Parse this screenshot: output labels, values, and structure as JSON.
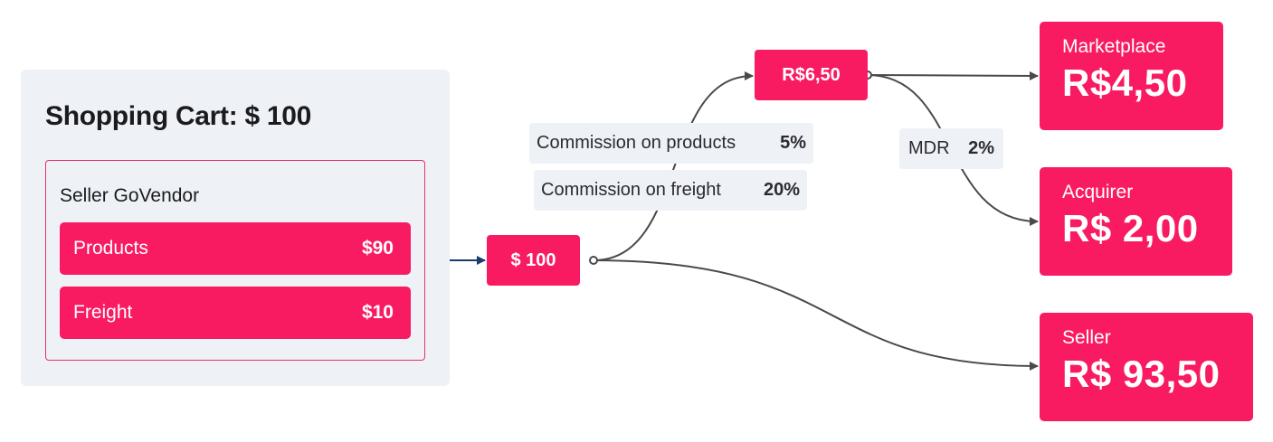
{
  "cart": {
    "title": "Shopping Cart: $ 100",
    "seller_name": "Seller GoVendor",
    "items": [
      {
        "label": "Products",
        "amount": "$90"
      },
      {
        "label": "Freight",
        "amount": "$10"
      }
    ]
  },
  "flow": {
    "total": "$ 100",
    "fee_total": "R$6,50",
    "commissions": [
      {
        "label": "Commission on products",
        "value": "5%"
      },
      {
        "label": "Commission on freight",
        "value": "20%"
      }
    ],
    "mdr": {
      "label": "MDR",
      "value": "2%"
    }
  },
  "destinations": {
    "marketplace": {
      "label": "Marketplace",
      "value": "R$4,50"
    },
    "acquirer": {
      "label": "Acquirer",
      "value": "R$ 2,00"
    },
    "seller": {
      "label": "Seller",
      "value": "R$ 93,50"
    }
  },
  "colors": {
    "accent": "#f81b62",
    "panel": "#eef2f6",
    "connector_dark": "#4a4a4a",
    "connector_blue": "#1c3a6e"
  }
}
